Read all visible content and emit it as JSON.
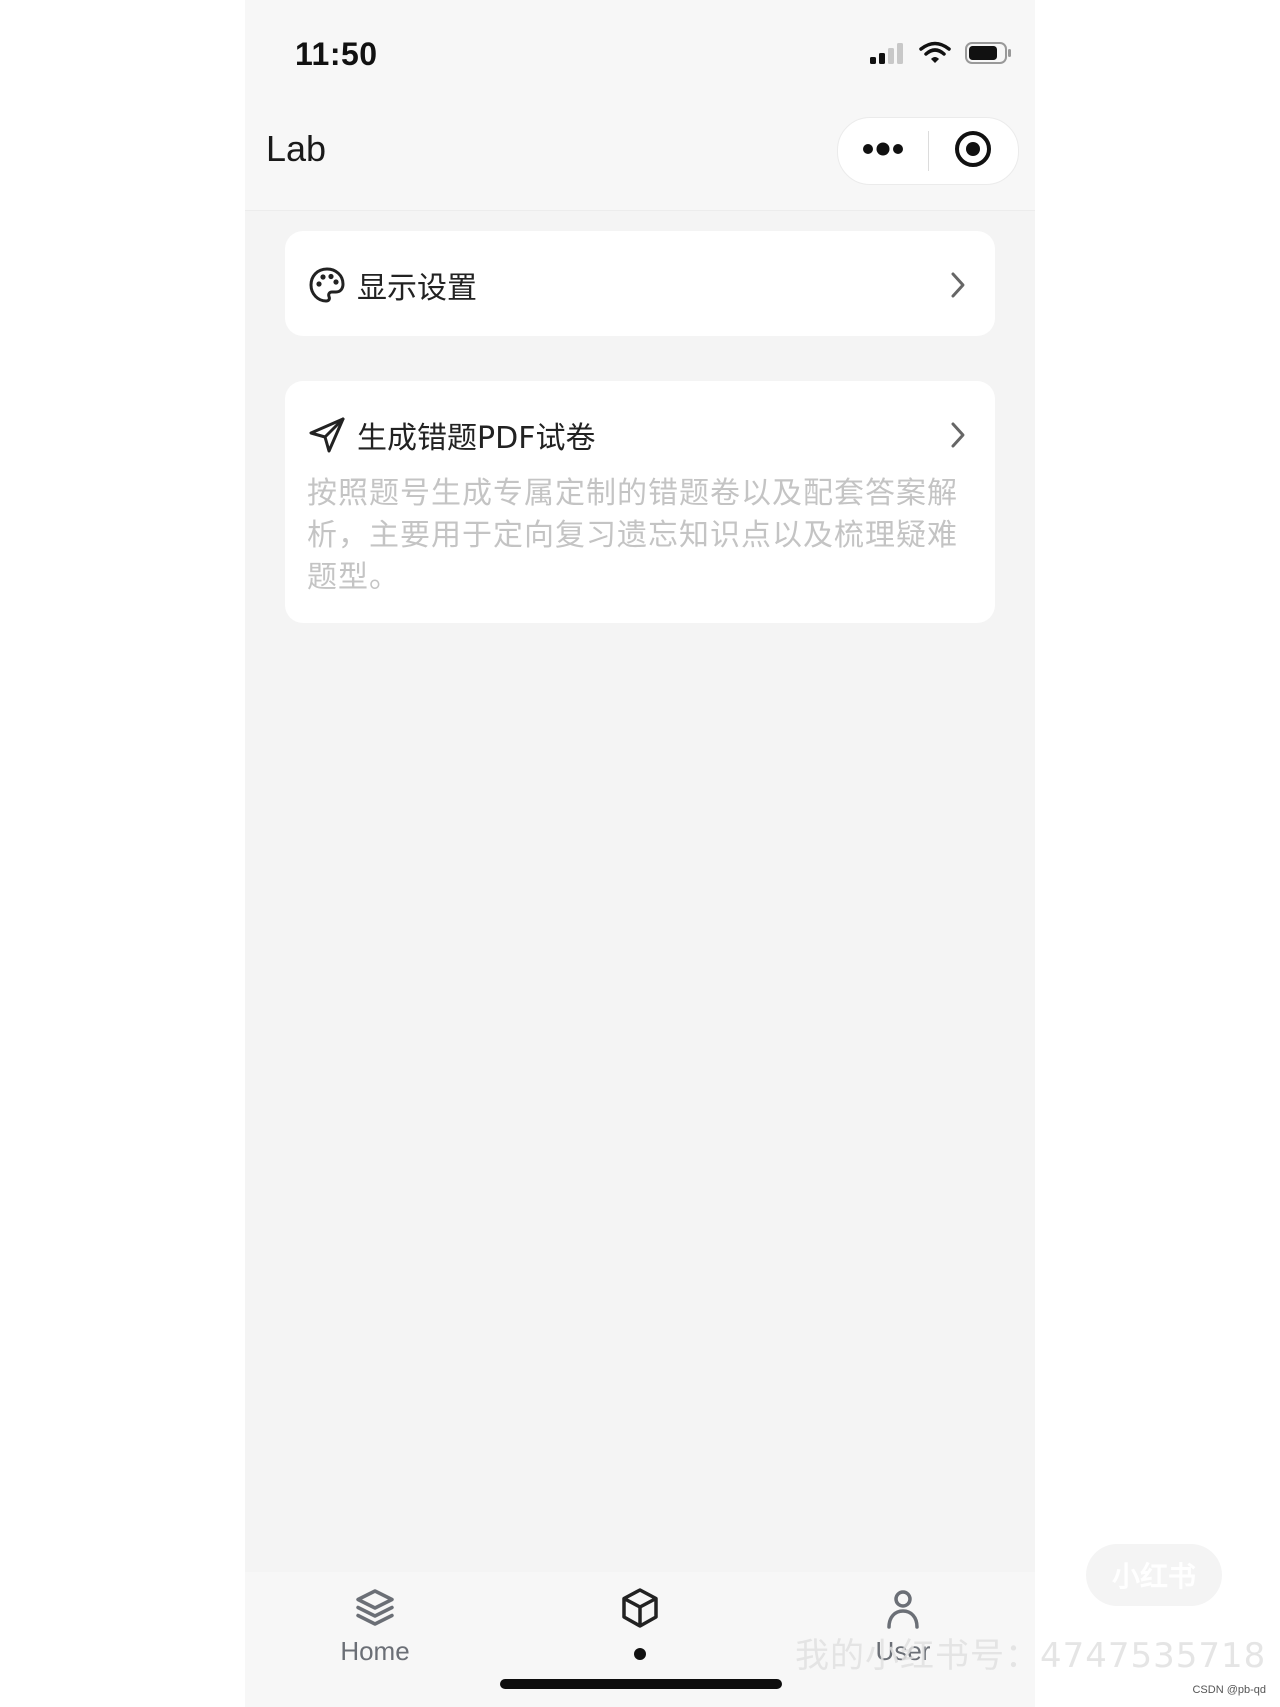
{
  "status_bar": {
    "time": "11:50",
    "icons": [
      "signal-icon",
      "wifi-icon",
      "battery-icon"
    ]
  },
  "nav_bar": {
    "title": "Lab",
    "capsule": [
      "more-icon",
      "target-close-icon"
    ]
  },
  "cards": [
    {
      "icon": "palette-icon",
      "title": "显示设置"
    },
    {
      "icon": "send-icon",
      "title": "生成错题PDF试卷",
      "description": "按照题号生成专属定制的错题卷以及配套答案解析，主要用于定向复习遗忘知识点以及梳理疑难题型。"
    }
  ],
  "tab_bar": {
    "tabs": [
      {
        "icon": "layers-icon",
        "label": "Home"
      },
      {
        "icon": "cube-icon",
        "label": "",
        "active": true
      },
      {
        "icon": "user-icon",
        "label": "User"
      }
    ]
  },
  "watermarks": {
    "logo_text": "小红书",
    "account_text": "我的小红书号：4747535718",
    "csdn_text": "CSDN @pb-qd"
  },
  "colors": {
    "page_background": "#f4f4f4",
    "card_background": "#ffffff",
    "title_text": "#222222",
    "description_text": "#c4c4c4",
    "tab_label": "#6b6f76"
  }
}
